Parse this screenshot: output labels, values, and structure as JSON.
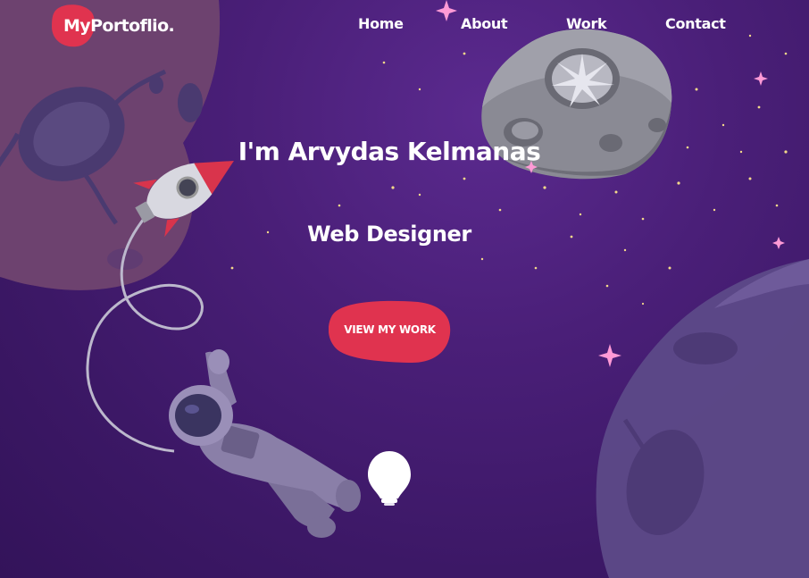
{
  "brand": {
    "logo_text": "MyPortoflio.",
    "accent_color": "#e0334f"
  },
  "nav": {
    "items": [
      {
        "label": "Home"
      },
      {
        "label": "About"
      },
      {
        "label": "Work"
      },
      {
        "label": "Contact"
      }
    ]
  },
  "hero": {
    "title": "I'm Arvydas Kelmanas",
    "subtitle": "Web Designer",
    "cta_label": "VIEW MY WORK"
  },
  "illustrations": {
    "icons": [
      "planet-icon",
      "asteroid-icon",
      "rocket-icon",
      "astronaut-icon",
      "lightbulb-icon"
    ]
  }
}
